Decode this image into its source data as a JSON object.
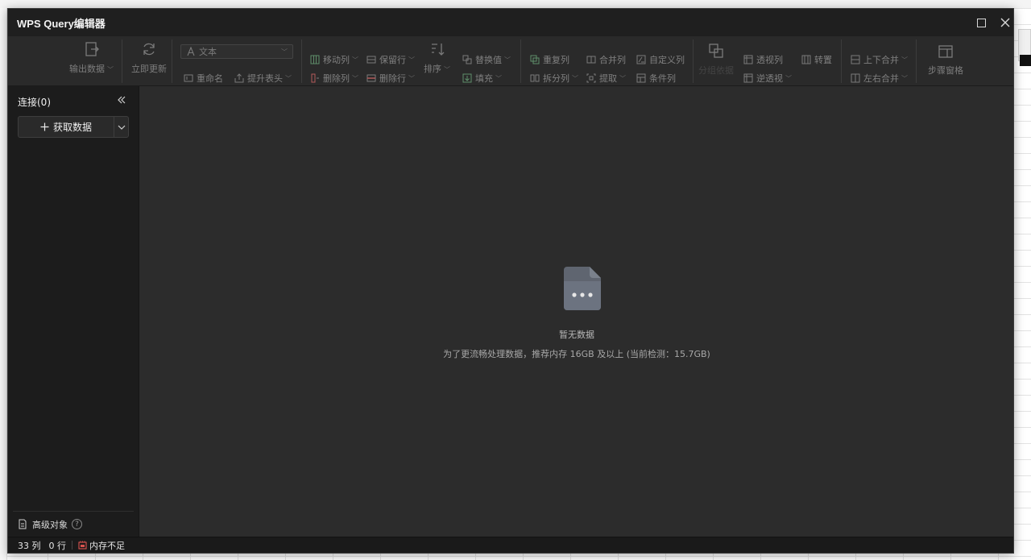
{
  "window": {
    "title": "WPS Query编辑器"
  },
  "toolbar": {
    "export_label": "输出数据",
    "refresh_label": "立即更新",
    "type_select_value": "文本",
    "rename_label": "重命名",
    "promote_header_label": "提升表头",
    "move_col_label": "移动列",
    "delete_col_label": "删除列",
    "keep_rows_label": "保留行",
    "delete_rows_label": "删除行",
    "sort_label": "排序",
    "replace_label": "替换值",
    "fill_label": "填充",
    "dup_col_label": "重复列",
    "split_col_label": "拆分列",
    "merge_col_label": "合并列",
    "extract_label": "提取",
    "custom_col_label": "自定义列",
    "cond_col_label": "条件列",
    "group_label": "分组依据",
    "pivot_label": "透视列",
    "unpivot_label": "逆透视",
    "transpose_label": "转置",
    "append_label": "上下合并",
    "merge_label": "左右合并",
    "steps_label": "步骤窗格"
  },
  "sidebar": {
    "title": "连接(0)",
    "get_data_label": "获取数据",
    "advanced_label": "高级对象"
  },
  "main": {
    "empty_title": "暂无数据",
    "empty_hint": "为了更流畅处理数据，推荐内存 16GB 及以上 (当前检测：15.7GB)"
  },
  "status": {
    "columns": "33 列",
    "rows": "0 行",
    "memory": "内存不足"
  },
  "colors": {
    "accent_green": "#3f8f5c",
    "warning_red": "#d9534f"
  }
}
